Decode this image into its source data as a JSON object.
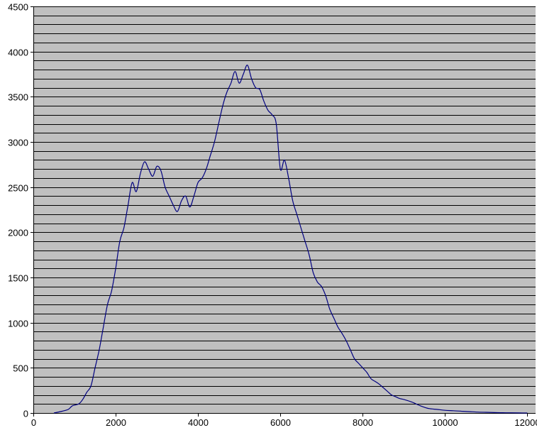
{
  "chart_data": {
    "type": "line",
    "title": "",
    "xlabel": "",
    "ylabel": "",
    "xlim": [
      0,
      12200
    ],
    "ylim": [
      0,
      4500
    ],
    "x_ticks": [
      0,
      2000,
      4000,
      6000,
      8000,
      10000,
      12000
    ],
    "x_tick_labels": [
      "0",
      "2000",
      "4000",
      "6000",
      "8000",
      "10000",
      "12000"
    ],
    "y_ticks": [
      0,
      500,
      1000,
      1500,
      2000,
      2500,
      3000,
      3500,
      4000,
      4500
    ],
    "y_tick_labels": [
      "0",
      "500",
      "1000",
      "1500",
      "2000",
      "2500",
      "3000",
      "3500",
      "4000",
      "4500"
    ],
    "y_gridline_step": 100,
    "grid": true,
    "legend": "none",
    "colors": {
      "background": "#c0c0c0",
      "gridline": "#000000",
      "series": "#000080"
    },
    "series": [
      {
        "x": [
          500,
          700,
          850,
          950,
          1100,
          1200,
          1300,
          1400,
          1500,
          1600,
          1700,
          1800,
          1900,
          2000,
          2100,
          2200,
          2300,
          2400,
          2500,
          2600,
          2700,
          2800,
          2900,
          3000,
          3100,
          3200,
          3300,
          3400,
          3500,
          3600,
          3700,
          3800,
          3900,
          4000,
          4100,
          4200,
          4300,
          4400,
          4500,
          4600,
          4700,
          4800,
          4900,
          5000,
          5100,
          5200,
          5300,
          5400,
          5500,
          5600,
          5700,
          5800,
          5900,
          6000,
          6100,
          6200,
          6300,
          6400,
          6500,
          6600,
          6700,
          6800,
          6900,
          7000,
          7100,
          7200,
          7300,
          7400,
          7500,
          7600,
          7700,
          7800,
          7900,
          8000,
          8100,
          8200,
          8300,
          8400,
          8500,
          8600,
          8700,
          8800,
          8900,
          9000,
          9200,
          9400,
          9600,
          9800,
          10000,
          10200,
          10400,
          10600,
          10800,
          11000,
          11200,
          11400,
          11600,
          11800,
          12000
        ],
        "y": [
          0,
          20,
          40,
          80,
          100,
          150,
          230,
          300,
          500,
          700,
          950,
          1200,
          1350,
          1600,
          1900,
          2050,
          2300,
          2550,
          2450,
          2650,
          2780,
          2700,
          2620,
          2730,
          2680,
          2500,
          2400,
          2300,
          2230,
          2350,
          2400,
          2280,
          2400,
          2550,
          2600,
          2700,
          2850,
          3000,
          3200,
          3400,
          3550,
          3650,
          3780,
          3650,
          3750,
          3850,
          3700,
          3600,
          3580,
          3450,
          3350,
          3300,
          3200,
          2700,
          2800,
          2600,
          2350,
          2200,
          2050,
          1900,
          1750,
          1550,
          1450,
          1400,
          1300,
          1150,
          1050,
          950,
          880,
          800,
          700,
          600,
          550,
          500,
          450,
          380,
          350,
          320,
          280,
          240,
          200,
          180,
          160,
          150,
          120,
          80,
          50,
          40,
          30,
          25,
          20,
          15,
          10,
          8,
          5,
          3,
          2,
          1,
          0
        ]
      }
    ]
  }
}
